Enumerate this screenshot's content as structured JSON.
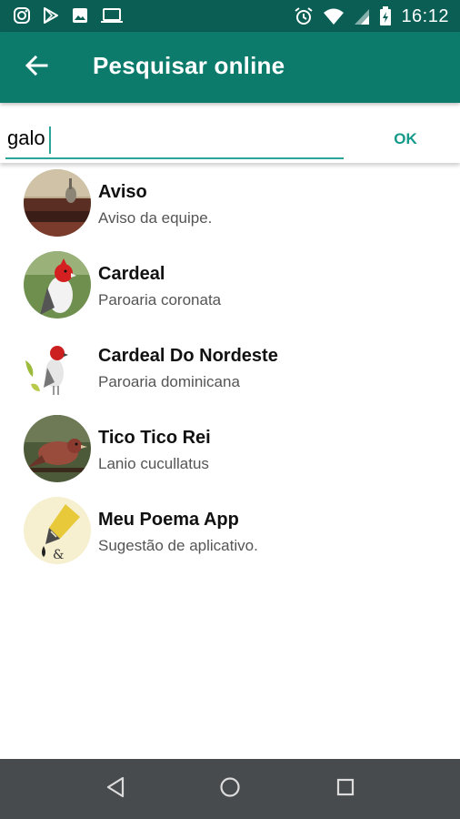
{
  "status_bar": {
    "time": "16:12",
    "left_icons": [
      "instagram-icon",
      "play-store-icon",
      "image-icon",
      "laptop-icon"
    ],
    "right_icons": [
      "alarm-icon",
      "wifi-icon",
      "signal-icon",
      "battery-icon"
    ]
  },
  "app_bar": {
    "title": "Pesquisar online",
    "back_icon": "arrow-back-icon",
    "color": "#0c7b6c"
  },
  "search": {
    "value": "galo",
    "ok_label": "OK",
    "accent": "#2aa597"
  },
  "results": [
    {
      "title": "Aviso",
      "subtitle": "Aviso da equipe.",
      "avatar": "bird-on-branch-avatar"
    },
    {
      "title": "Cardeal",
      "subtitle": "Paroaria coronata",
      "avatar": "red-crested-cardinal-avatar"
    },
    {
      "title": "Cardeal Do Nordeste",
      "subtitle": "Paroaria dominicana",
      "avatar": "red-cowled-cardinal-avatar"
    },
    {
      "title": "Tico Tico Rei",
      "subtitle": "Lanio cucullatus",
      "avatar": "brown-bird-avatar"
    },
    {
      "title": "Meu Poema App",
      "subtitle": "Sugestão de aplicativo.",
      "avatar": "fountain-pen-avatar"
    }
  ],
  "nav_bar": {
    "buttons": [
      "back-triangle-icon",
      "home-circle-icon",
      "recents-square-icon"
    ]
  }
}
